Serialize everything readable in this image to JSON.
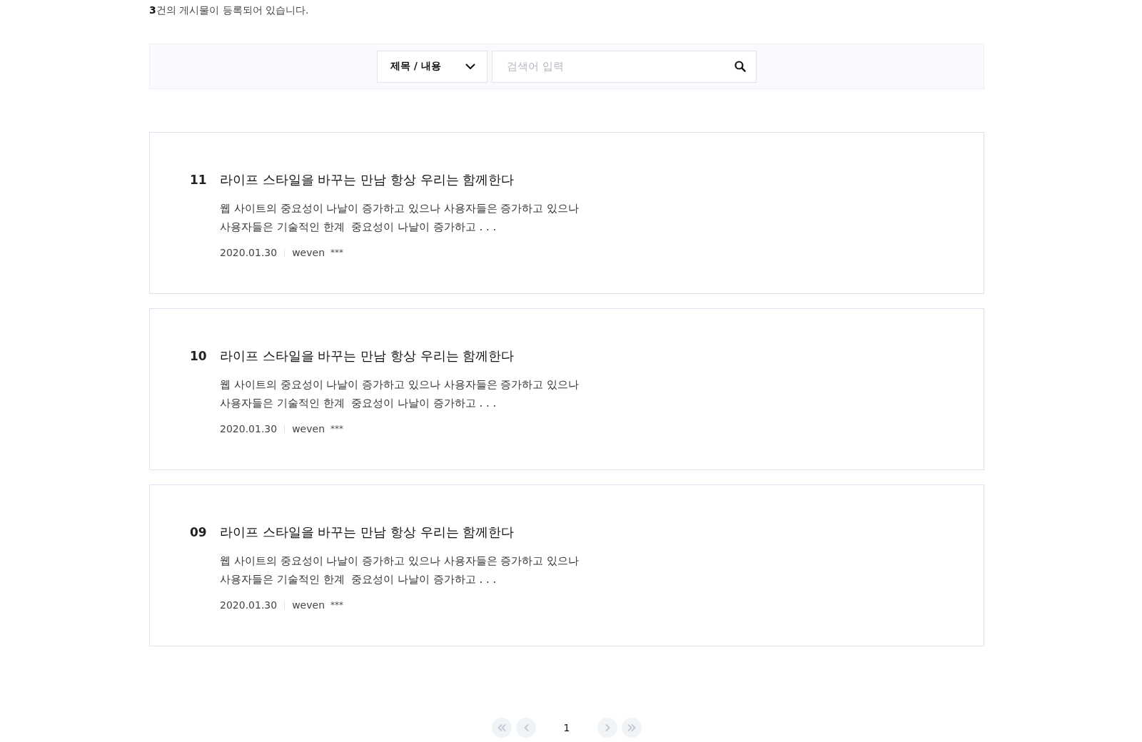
{
  "post_count_text": "**3**건의 게시물이 등록되어 있습니다.",
  "search": {
    "field_select": "제목 / 내용",
    "placeholder": "검색어 입력"
  },
  "posts": [
    {
      "number": "11",
      "title": "라이프 스타일을 바꾸는 만남 항상 우리는 함께한다",
      "excerpt": "웹 사이트의 중요성이 나날이 증가하고 있으나 사용자들은 증가하고 있으나\n사용자들은 기술적인 한계  중요성이 나날이 증가하고 . . .",
      "date": "2020.01.30",
      "author": "weven",
      "author_mask": "***"
    },
    {
      "number": "10",
      "title": "라이프 스타일을 바꾸는 만남 항상 우리는 함께한다",
      "excerpt": "웹 사이트의 중요성이 나날이 증가하고 있으나 사용자들은 증가하고 있으나\n사용자들은 기술적인 한계  중요성이 나날이 증가하고 . . .",
      "date": "2020.01.30",
      "author": "weven",
      "author_mask": "***"
    },
    {
      "number": "09",
      "title": "라이프 스타일을 바꾸는 만남 항상 우리는 함께한다",
      "excerpt": "웹 사이트의 중요성이 나날이 증가하고 있으나 사용자들은 증가하고 있으나\n사용자들은 기술적인 한계  중요성이 나날이 증가하고 . . .",
      "date": "2020.01.30",
      "author": "weven",
      "author_mask": "***"
    }
  ],
  "pagination": {
    "pages": [
      {
        "label": "1",
        "selected": true
      }
    ]
  }
}
